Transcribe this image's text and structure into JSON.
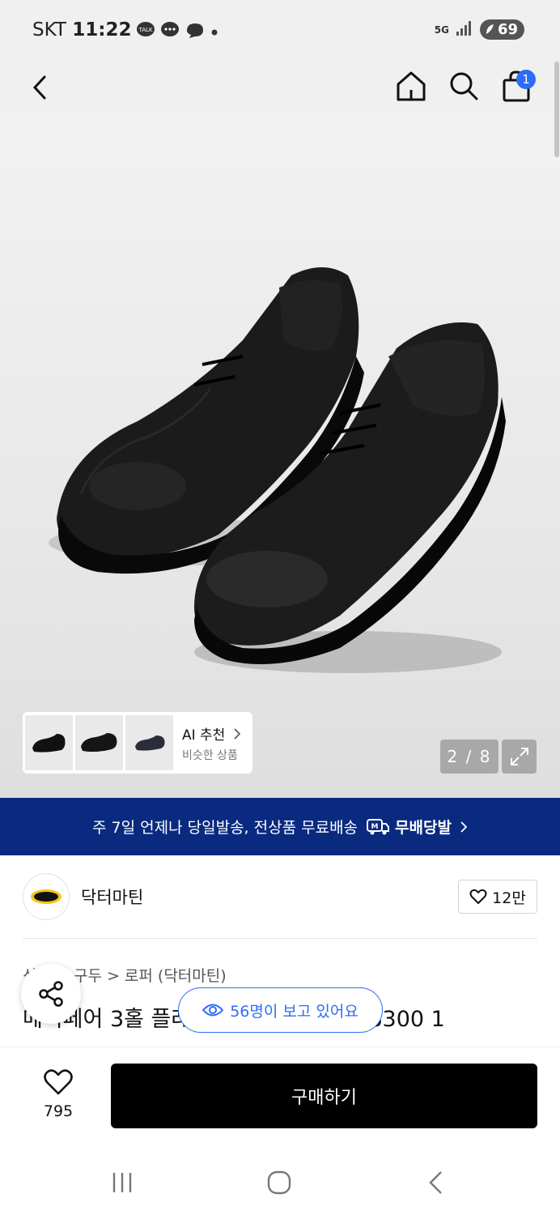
{
  "status_bar": {
    "carrier": "SKT",
    "time": "11:22",
    "network": "5G",
    "battery": "69"
  },
  "header": {
    "cart_badge": "1"
  },
  "gallery": {
    "ai_title": "AI 추천",
    "ai_subtitle": "비슷한 상품",
    "counter": "2 / 8"
  },
  "promo": {
    "text": "주 7일 언제나 당일발송, 전상품 무료배송",
    "brand": "무배당발"
  },
  "brand": {
    "name": "닥터마틴",
    "likes": "12만"
  },
  "product": {
    "breadcrumb": "신발 > 구두 > 로퍼 (닥터마틴)",
    "title": "메이페어 3홀 플레인 슈즈 블랙 / 4286300 1"
  },
  "viewers": {
    "text": "56명이 보고 있어요"
  },
  "bottom": {
    "wish_count": "795",
    "buy_label": "구매하기"
  },
  "colors": {
    "banner": "#0a2a80",
    "accent": "#2b6df6",
    "buy_button": "#000000"
  }
}
